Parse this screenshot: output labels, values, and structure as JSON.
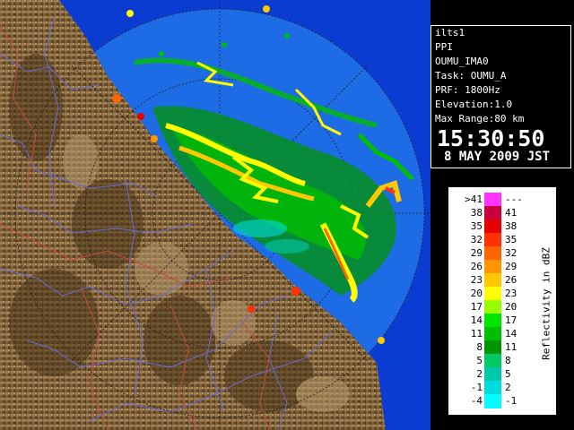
{
  "info": {
    "radar_id": "ilts1",
    "product": "PPI",
    "site": "OUMU_IMA0",
    "task": "Task: OUMU_A",
    "prf": "PRF: 1800Hz",
    "elevation": "Elevation:1.0",
    "max_range": "Max Range:80 km",
    "time": "15:30:50",
    "date": "8 MAY 2009 JST"
  },
  "legend": {
    "unit": "Reflectivity in dBZ",
    "rows": [
      {
        "lo": ">41",
        "hi": "---",
        "color": "#ff33ff"
      },
      {
        "lo": "38",
        "hi": "41",
        "color": "#c8003c"
      },
      {
        "lo": "35",
        "hi": "38",
        "color": "#e60000"
      },
      {
        "lo": "32",
        "hi": "35",
        "color": "#ff3200"
      },
      {
        "lo": "29",
        "hi": "32",
        "color": "#ff6400"
      },
      {
        "lo": "26",
        "hi": "29",
        "color": "#ff9600"
      },
      {
        "lo": "23",
        "hi": "26",
        "color": "#ffc800"
      },
      {
        "lo": "20",
        "hi": "23",
        "color": "#ffff00"
      },
      {
        "lo": "17",
        "hi": "20",
        "color": "#96ff00"
      },
      {
        "lo": "14",
        "hi": "17",
        "color": "#00e600"
      },
      {
        "lo": "11",
        "hi": "14",
        "color": "#00be00"
      },
      {
        "lo": "8",
        "hi": "11",
        "color": "#009600"
      },
      {
        "lo": "5",
        "hi": "8",
        "color": "#00c864"
      },
      {
        "lo": "2",
        "hi": "5",
        "color": "#00c8aa"
      },
      {
        "lo": "-1",
        "hi": "2",
        "color": "#00dcdc"
      },
      {
        "lo": "-4",
        "hi": "-1",
        "color": "#00ffff"
      }
    ]
  },
  "map": {
    "background_blue": "#1e6be6",
    "outer_blue": "#0a3cd2",
    "land_color": "#8a6a40",
    "river_color": "#6a6ad8",
    "boundary_color": "#c84a3c"
  }
}
